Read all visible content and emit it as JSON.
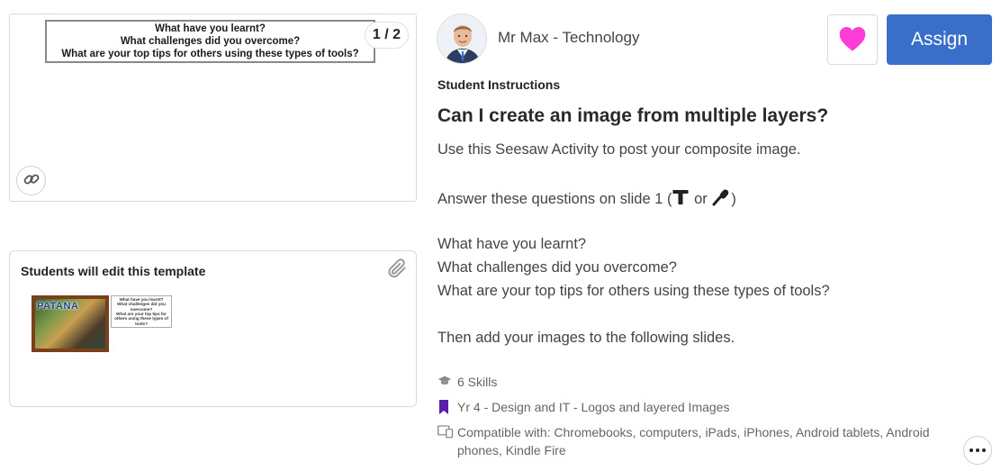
{
  "preview": {
    "slide_lines": [
      "What have you learnt?",
      "What challenges did you overcome?",
      "What are your top tips for others using these types of tools?"
    ],
    "page_count": "1 / 2",
    "link_icon": "link-icon"
  },
  "template": {
    "title": "Students will edit this template",
    "clip_icon": "paperclip-icon",
    "thumb_brand": "PATANA",
    "thumb_lines": [
      "What have you learnt?",
      "What challenges did you",
      "overcome?",
      "What are your top tips for",
      "others using these types of",
      "tools?"
    ]
  },
  "header": {
    "author": "Mr Max - Technology",
    "like_icon": "heart-icon",
    "like_color": "#ff3dd6",
    "assign_label": "Assign",
    "assign_color": "#3a6fc9"
  },
  "instructions": {
    "label": "Student Instructions",
    "title": "Can I create an image from multiple layers?",
    "line1": "Use this Seesaw Activity to post your composite image.",
    "line2_prefix": "Answer these questions on slide 1 (",
    "line2_or": "or",
    "line2_suffix": ")",
    "q1": "What have you learnt?",
    "q2": "What challenges did you overcome?",
    "q3": "What are your top tips for others using these types of tools?",
    "closing": "Then add your images to the following slides."
  },
  "meta": {
    "skills": "6 Skills",
    "skills_icon": "graduation-cap-icon",
    "folder": "Yr 4 - Design and IT - Logos and layered Images",
    "folder_icon": "bookmark-icon",
    "folder_color": "#5a1fa8",
    "compat_line1": "Compatible with: Chromebooks, computers, iPads, iPhones, Android tablets, Android",
    "compat_line2": "phones, Kindle Fire",
    "compat_icon": "devices-icon"
  },
  "more_icon": "more-options-icon"
}
